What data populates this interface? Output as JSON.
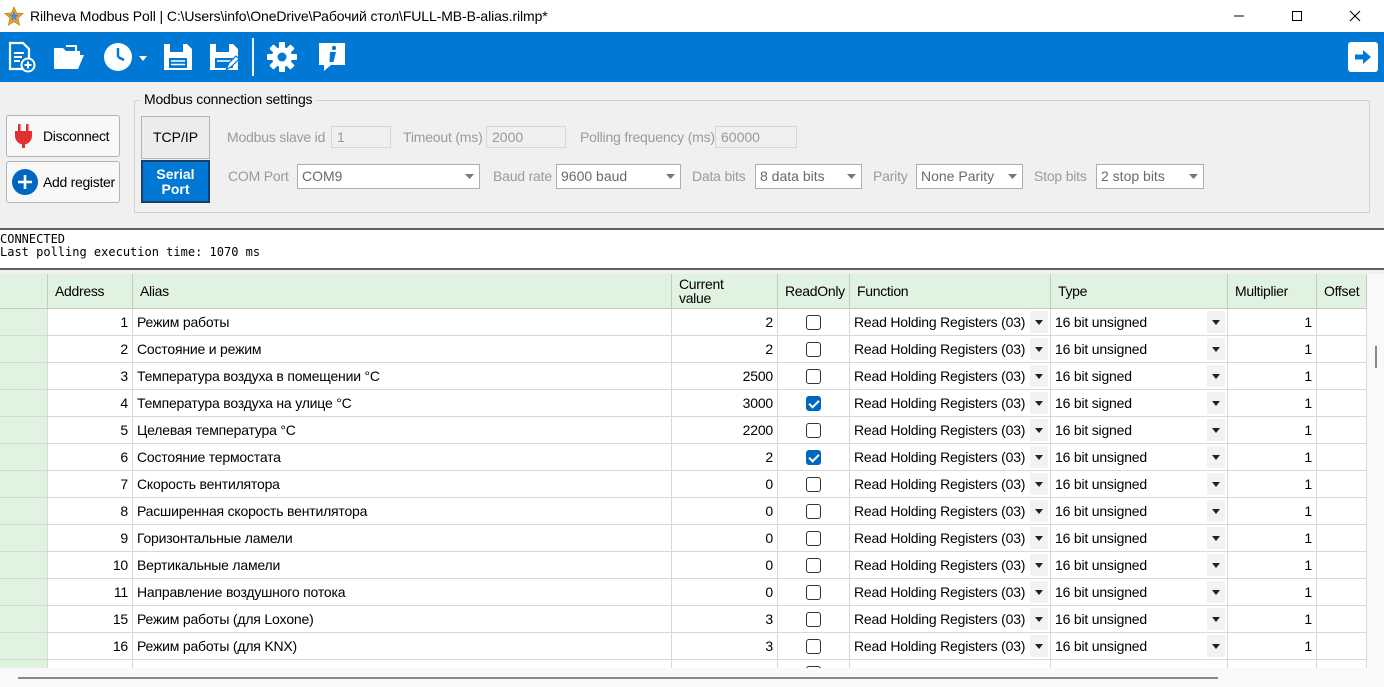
{
  "window": {
    "title": "Rilheva Modbus Poll | C:\\Users\\info\\OneDrive\\Рабочий стол\\FULL-MB-B-alias.rilmp*"
  },
  "toolbar": {
    "icons": [
      "new-file-icon",
      "open-folder-icon",
      "clock-icon",
      "save-icon",
      "save-as-icon",
      "gear-icon",
      "info-icon",
      "exit-arrow-icon"
    ]
  },
  "actions": {
    "disconnect_label": "Disconnect",
    "add_register_label": "Add register"
  },
  "connection": {
    "group_title": "Modbus connection settings",
    "tcp_label": "TCP/IP",
    "serial_label": "Serial Port",
    "slave_id_label": "Modbus slave id",
    "slave_id_value": "1",
    "timeout_label": "Timeout (ms)",
    "timeout_value": "2000",
    "polling_label": "Polling frequency (ms)",
    "polling_value": "60000",
    "com_port_label": "COM Port",
    "com_port_value": "COM9",
    "baud_label": "Baud rate",
    "baud_value": "9600 baud",
    "data_bits_label": "Data bits",
    "data_bits_value": "8 data bits",
    "parity_label": "Parity",
    "parity_value": "None Parity",
    "stop_bits_label": "Stop bits",
    "stop_bits_value": "2 stop bits"
  },
  "status": {
    "line1": "CONNECTED",
    "line2": "Last polling execution time: 1070 ms"
  },
  "grid": {
    "headers": {
      "address": "Address",
      "alias": "Alias",
      "current_value": "Current value",
      "readonly": "ReadOnly",
      "function": "Function",
      "type": "Type",
      "multiplier": "Multiplier",
      "offset": "Offset"
    },
    "rows": [
      {
        "address": "1",
        "alias": "Режим работы",
        "value": "2",
        "readonly": false,
        "function": "Read Holding Registers (03)",
        "type": "16 bit unsigned",
        "multiplier": "1",
        "offset": ""
      },
      {
        "address": "2",
        "alias": "Состояние и режим",
        "value": "2",
        "readonly": false,
        "function": "Read Holding Registers (03)",
        "type": "16 bit unsigned",
        "multiplier": "1",
        "offset": ""
      },
      {
        "address": "3",
        "alias": "Температура воздуха в помещении °C",
        "value": "2500",
        "readonly": false,
        "function": "Read Holding Registers (03)",
        "type": "16 bit signed",
        "multiplier": "1",
        "offset": ""
      },
      {
        "address": "4",
        "alias": "Температура воздуха на улице °C",
        "value": "3000",
        "readonly": true,
        "function": "Read Holding Registers (03)",
        "type": "16 bit signed",
        "multiplier": "1",
        "offset": ""
      },
      {
        "address": "5",
        "alias": "Целевая температура  °C",
        "value": "2200",
        "readonly": false,
        "function": "Read Holding Registers (03)",
        "type": "16 bit signed",
        "multiplier": "1",
        "offset": ""
      },
      {
        "address": "6",
        "alias": "Состояние термостата",
        "value": "2",
        "readonly": true,
        "function": "Read Holding Registers (03)",
        "type": "16 bit unsigned",
        "multiplier": "1",
        "offset": ""
      },
      {
        "address": "7",
        "alias": "Скорость вентилятора",
        "value": "0",
        "readonly": false,
        "function": "Read Holding Registers (03)",
        "type": "16 bit unsigned",
        "multiplier": "1",
        "offset": ""
      },
      {
        "address": "8",
        "alias": "Расширенная скорость вентилятора",
        "value": "0",
        "readonly": false,
        "function": "Read Holding Registers (03)",
        "type": "16 bit unsigned",
        "multiplier": "1",
        "offset": ""
      },
      {
        "address": "9",
        "alias": "Горизонтальные ламели",
        "value": "0",
        "readonly": false,
        "function": "Read Holding Registers (03)",
        "type": "16 bit unsigned",
        "multiplier": "1",
        "offset": ""
      },
      {
        "address": "10",
        "alias": "Вертикальные ламели",
        "value": "0",
        "readonly": false,
        "function": "Read Holding Registers (03)",
        "type": "16 bit unsigned",
        "multiplier": "1",
        "offset": ""
      },
      {
        "address": "11",
        "alias": "Направление воздушного потока",
        "value": "0",
        "readonly": false,
        "function": "Read Holding Registers (03)",
        "type": "16 bit unsigned",
        "multiplier": "1",
        "offset": ""
      },
      {
        "address": "15",
        "alias": "Режим работы (для Loxone)",
        "value": "3",
        "readonly": false,
        "function": "Read Holding Registers (03)",
        "type": "16 bit unsigned",
        "multiplier": "1",
        "offset": ""
      },
      {
        "address": "16",
        "alias": "Режим работы (для KNX)",
        "value": "3",
        "readonly": false,
        "function": "Read Holding Registers (03)",
        "type": "16 bit unsigned",
        "multiplier": "1",
        "offset": ""
      }
    ]
  }
}
